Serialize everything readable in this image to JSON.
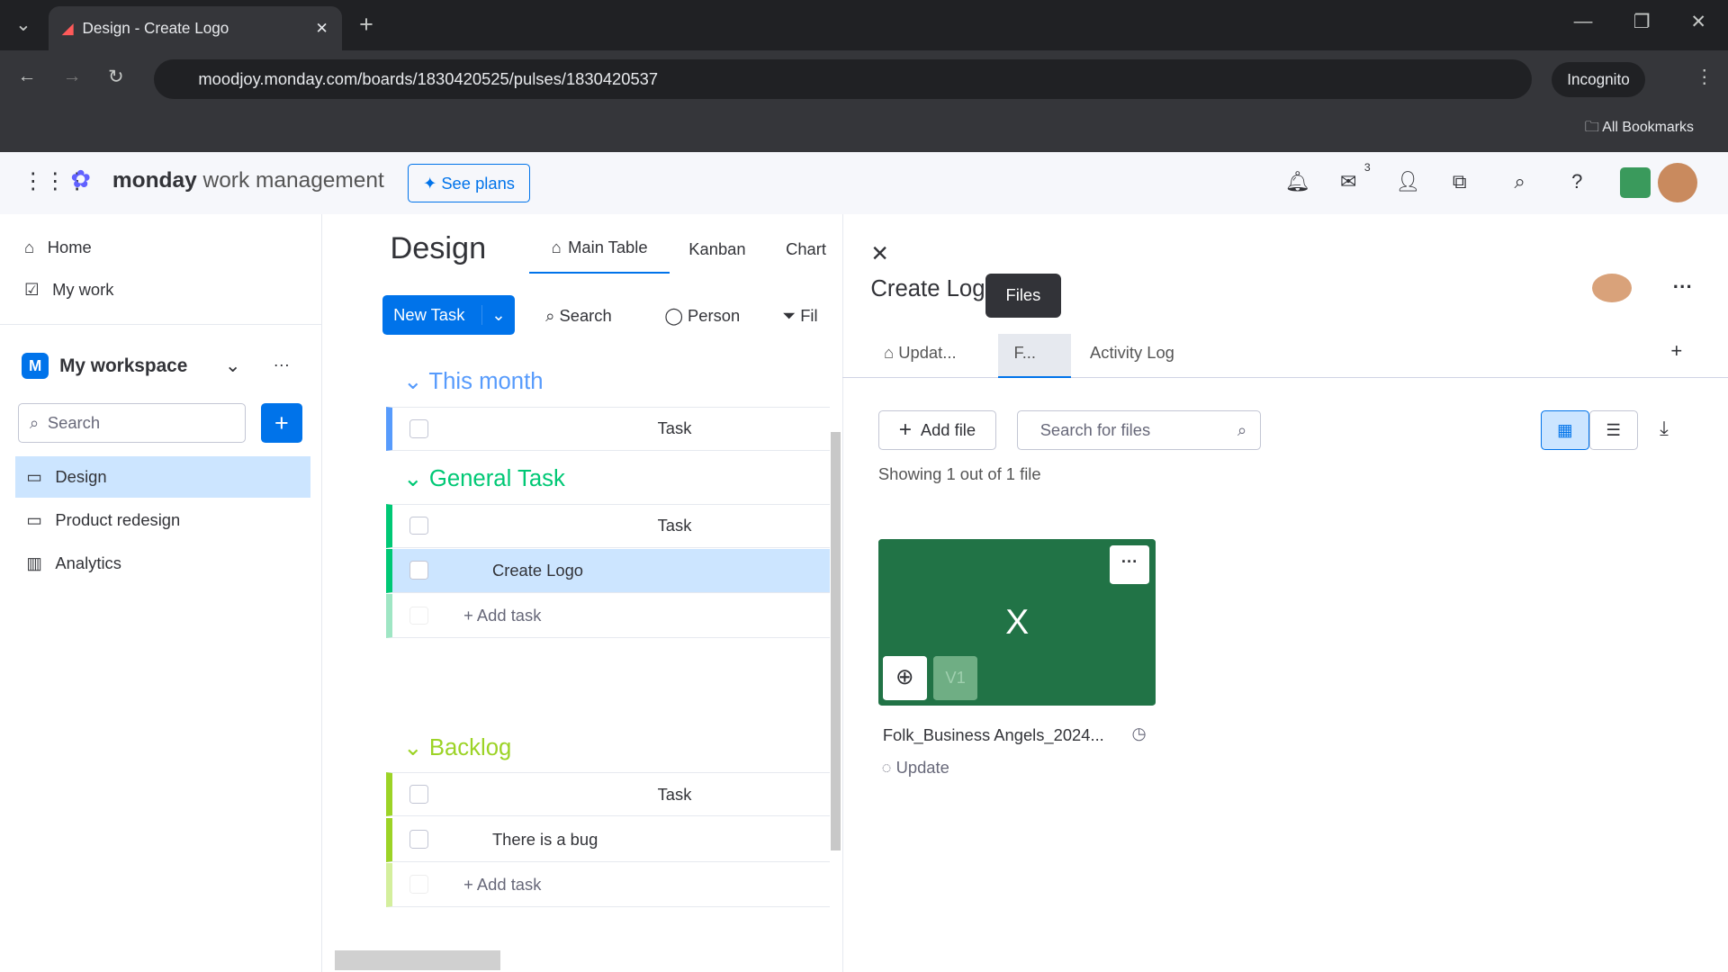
{
  "browser": {
    "tab_title": "Design - Create Logo",
    "url": "moodjoy.monday.com/boards/1830420525/pulses/1830420537",
    "incognito": "Incognito",
    "bookmarks": "All Bookmarks"
  },
  "app": {
    "brand": "monday",
    "brand_sub": "work management",
    "see_plans": "See plans",
    "inbox_badge": "3"
  },
  "sidebar": {
    "home": "Home",
    "my_work": "My work",
    "workspace": "My workspace",
    "workspace_initial": "M",
    "search_placeholder": "Search",
    "items": [
      {
        "label": "Design"
      },
      {
        "label": "Product redesign"
      },
      {
        "label": "Analytics"
      }
    ]
  },
  "board": {
    "title": "Design",
    "views": [
      "Main Table",
      "Kanban",
      "Chart"
    ],
    "new_task": "New Task",
    "search": "Search",
    "person": "Person",
    "filter": "Fil",
    "groups": [
      {
        "name": "This month",
        "color": "#579bfc",
        "header": "Task",
        "tasks": []
      },
      {
        "name": "General Task",
        "color": "#00c875",
        "header": "Task",
        "tasks": [
          "Create Logo"
        ],
        "add": "+ Add task"
      },
      {
        "name": "Backlog",
        "color": "#9cd326",
        "header": "Task",
        "tasks": [
          "There is a bug"
        ],
        "add": "+ Add task"
      }
    ]
  },
  "panel": {
    "title": "Create Logo",
    "tooltip": "Files",
    "tabs": [
      "Updat...",
      "F...",
      "Activity Log"
    ],
    "add_file": "Add file",
    "search_placeholder": "Search for files",
    "showing": "Showing 1 out of 1 file",
    "file": {
      "glyph": "X",
      "version": "V1",
      "name": "Folk_Business Angels_2024...",
      "update": "Update",
      "color": "#217346"
    }
  }
}
